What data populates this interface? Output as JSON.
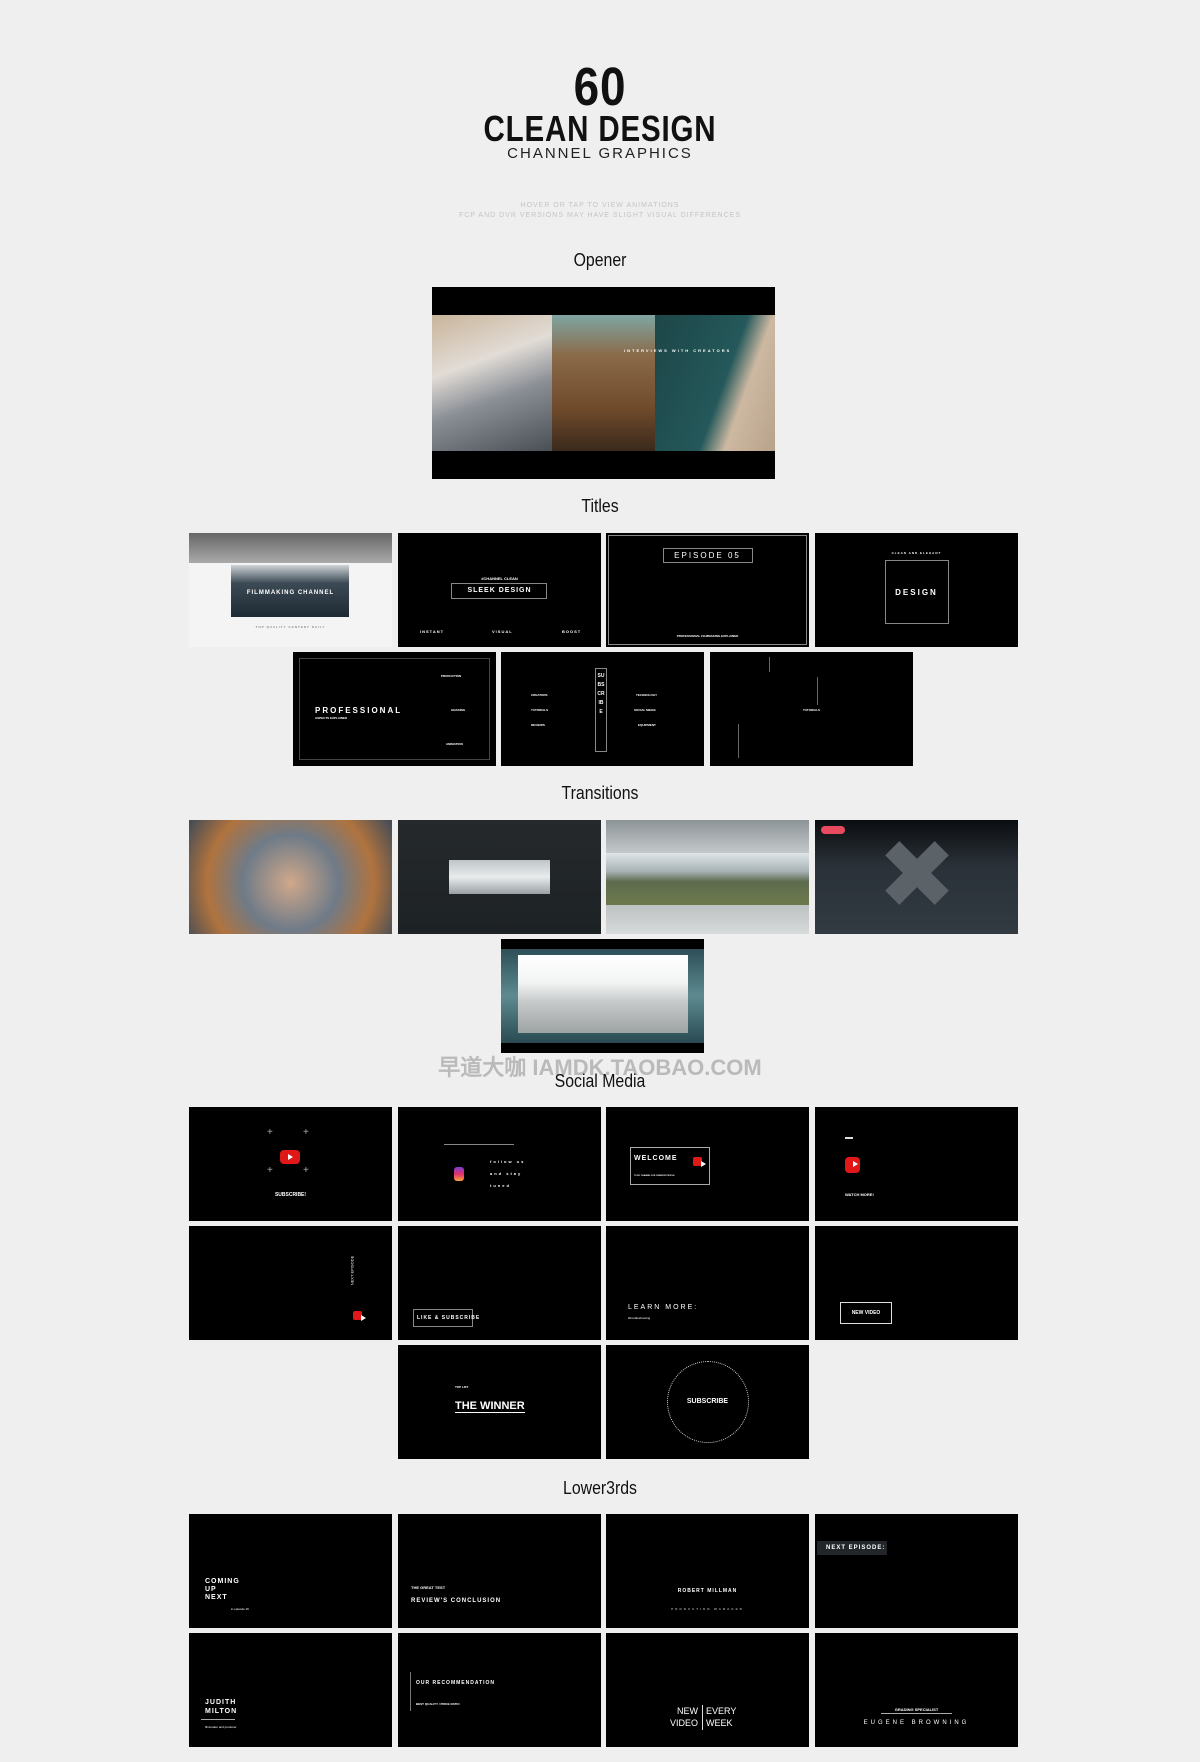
{
  "header": {
    "count": "60",
    "title": "CLEAN DESIGN",
    "subtitle": "CHANNEL GRAPHICS",
    "note1": "HOVER OR TAP TO VIEW ANIMATIONS",
    "note2": "FCP AND DVR VERSIONS MAY HAVE SLIGHT VISUAL DIFFERENCES"
  },
  "opener": {
    "label": "Opener",
    "overlay": "INTERVIEWS WITH CREATORS"
  },
  "titles": {
    "label": "Titles",
    "c1": {
      "main": "FILMMAKING CHANNEL",
      "sub": "TOP QUALITY CONTENT DAILY"
    },
    "c2": {
      "top": "#CHANNEL CLEAN",
      "main": "SLEEK DESIGN",
      "w1": "INSTANT",
      "w2": "VISUAL",
      "w3": "BOOST"
    },
    "c3": {
      "main": "EPISODE 05",
      "sub": "PROFESSIONAL FILMMAKING EXPLAINED"
    },
    "c4": {
      "top": "CLEAN AND ELEGANT",
      "main": "DESIGN"
    },
    "c5": {
      "main": "PROFESSIONAL",
      "sub": "ASPECTS EXPLAINED",
      "r1": "PRODUCTION",
      "r2": "GRADING",
      "r3": "ANIMATION"
    },
    "c6": {
      "l1": "CREATORS",
      "l2": "TUTORIALS",
      "l3": "REVIEWS",
      "mid": "SUBSCRIBE",
      "r1": "TECHNOLOGY",
      "r2": "SOCIAL MEDIA",
      "r3": "EQUIPMENT"
    },
    "c7": {
      "main": "TUTORIALS"
    }
  },
  "transitions": {
    "label": "Transitions"
  },
  "watermark": "早道大咖  IAMDK.TAOBAO.COM",
  "social": {
    "label": "Social Media",
    "c1": "SUBSCRIBE!",
    "c2": [
      "follow us",
      "and stay",
      "tuned"
    ],
    "c3": {
      "main": "WELCOME",
      "sub": "TO MY CHANNEL FOR CREATIVE PEOPLE"
    },
    "c4": "WATCH MORE!",
    "c5": "NEXT EPISODE",
    "c6": "LIKE & SUBSCRIBE",
    "c7": {
      "main": "LEARN MORE:",
      "sub": "#troubleshooting"
    },
    "c8": "NEW VIDEO",
    "c9": {
      "top": "TOP LIST",
      "main": "THE WINNER"
    },
    "c10": "SUBSCRIBE"
  },
  "lower": {
    "label": "Lower3rds",
    "c1": {
      "main": [
        "COMING",
        "UP",
        "NEXT"
      ],
      "sub": "in episode 16"
    },
    "c2": {
      "top": "THE GREAT TEST",
      "main": "REVIEW'S CONCLUSION"
    },
    "c3": {
      "main": "ROBERT MILLMAN",
      "sub": "PRODUCTION MANAGER"
    },
    "c4": "NEXT EPISODE:",
    "c5": {
      "main": [
        "JUDITH",
        "MILTON"
      ],
      "sub": "filmmaker and producer"
    },
    "c6": {
      "main": "OUR RECOMMENDATION",
      "sub": "BEST QUALITY / PRICE RATIO"
    },
    "c7": [
      "NEW",
      "VIDEO",
      "EVERY",
      "WEEK"
    ],
    "c8": {
      "top": "GRADING SPECIALIST",
      "main": "EUGENE BROWNING"
    }
  },
  "colors": {
    "background": "#efefef",
    "card": "#000000",
    "youtube": "#e01818",
    "badge": "#e84a5f"
  }
}
